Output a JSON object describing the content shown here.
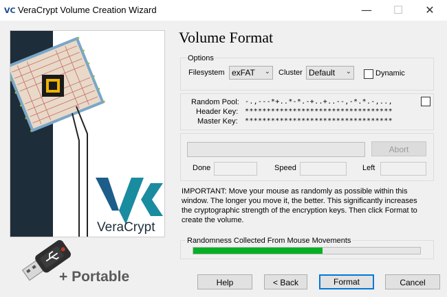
{
  "window": {
    "title": "VeraCrypt Volume Creation Wizard",
    "app_icon": "VC",
    "minimize_glyph": "—",
    "maximize_glyph": "☐",
    "close_glyph": "✕"
  },
  "banner": {
    "brand": "VeraCrypt",
    "portable_label": "+ Portable"
  },
  "page": {
    "heading": "Volume Format"
  },
  "options": {
    "group_label": "Options",
    "filesystem_label": "Filesystem",
    "filesystem_value": "exFAT",
    "cluster_label": "Cluster",
    "cluster_value": "Default",
    "dynamic_label": "Dynamic",
    "dynamic_checked": false
  },
  "keys": {
    "random_pool_label": "Random Pool:",
    "random_pool_value": "-.,---*+..*-*.-+..+..--,-*.*.-,..,",
    "header_key_label": "Header Key:",
    "header_key_value": "**********************************",
    "master_key_label": "Master Key:",
    "master_key_value": "**********************************"
  },
  "progress": {
    "abort_label": "Abort",
    "done_label": "Done",
    "done_value": "",
    "speed_label": "Speed",
    "speed_value": "",
    "left_label": "Left",
    "left_value": ""
  },
  "info": {
    "important_text": "IMPORTANT: Move your mouse as randomly as possible within this window. The longer you move it, the better. This significantly increases the cryptographic strength of the encryption keys. Then click Format to create the volume."
  },
  "randomness": {
    "label": "Randomness Collected From Mouse Movements",
    "level": 0.57,
    "color": "#06b025"
  },
  "buttons": {
    "help": "Help",
    "back": "< Back",
    "format": "Format",
    "cancel": "Cancel"
  },
  "colors": {
    "accent": "#0078d7",
    "brand_teal": "#1a8ca0",
    "brand_dark": "#1d5d8a"
  }
}
